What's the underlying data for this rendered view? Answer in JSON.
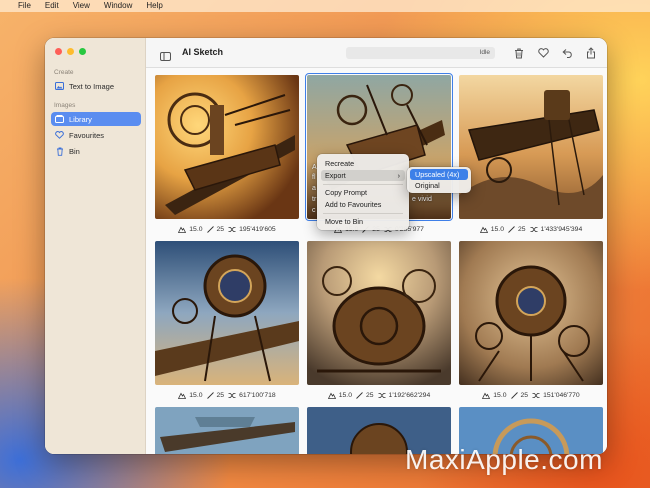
{
  "menubar": {
    "items": [
      "File",
      "Edit",
      "View",
      "Window",
      "Help"
    ]
  },
  "sidebar": {
    "sections": [
      {
        "label": "Create",
        "items": [
          {
            "label": "Text to Image",
            "icon": "image-icon"
          }
        ]
      },
      {
        "label": "Images",
        "items": [
          {
            "label": "Library",
            "icon": "library-icon",
            "active": true
          },
          {
            "label": "Favourites",
            "icon": "heart-icon"
          },
          {
            "label": "Bin",
            "icon": "trash-icon"
          }
        ]
      }
    ]
  },
  "toolbar": {
    "title": "AI Sketch",
    "status": "Idle",
    "icons": [
      "trash-icon",
      "heart-icon",
      "undo-icon",
      "share-icon"
    ]
  },
  "cards": [
    {
      "scale": "15.0",
      "steps": "25",
      "seed": "195'419'605"
    },
    {
      "scale": "15.0",
      "steps": "25",
      "seed": "0'285'977"
    },
    {
      "scale": "15.0",
      "steps": "25",
      "seed": "1'433'945'394"
    },
    {
      "scale": "15.0",
      "steps": "25",
      "seed": "617'100'718"
    },
    {
      "scale": "15.0",
      "steps": "25",
      "seed": "1'192'662'294"
    },
    {
      "scale": "15.0",
      "steps": "25",
      "seed": "151'046'770"
    }
  ],
  "overlay_fragments": [
    "A",
    "fl",
    "a",
    "tr",
    "c",
    "e vivid"
  ],
  "context_menu": {
    "items": [
      "Recreate",
      "Export",
      "Copy Prompt",
      "Add to Favourites",
      "Move to Bin"
    ],
    "submenu": [
      "Upscaled (4x)",
      "Original"
    ]
  },
  "watermark": "MaxiApple.com",
  "colors": {
    "accent": "#3d80e8",
    "sidebar_active": "#5a8df0"
  }
}
